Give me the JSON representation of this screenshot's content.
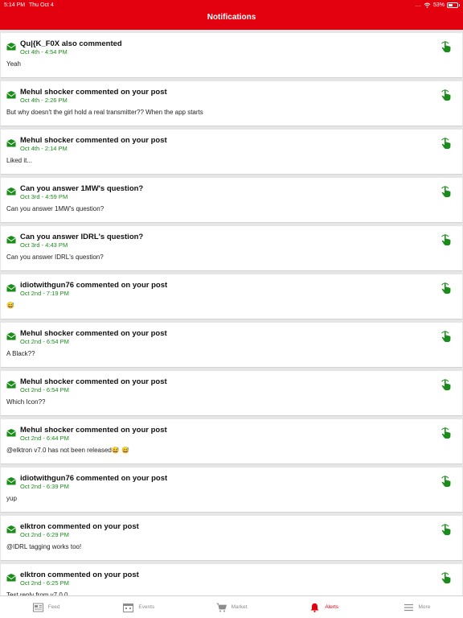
{
  "status": {
    "time": "5:14 PM",
    "date": "Thu Oct 4",
    "battery": "53%",
    "battery_level": 0.53
  },
  "header": {
    "title": "Notifications"
  },
  "notifications": [
    {
      "title": "Qu|{K_F0X also commented",
      "time": "Oct 4th - 4:54 PM",
      "text": "Yeah"
    },
    {
      "title": "Mehul shocker commented on your post",
      "time": "Oct 4th - 2:26 PM",
      "text": "But why doesn't the girl hold a real transmitter?? When the app starts"
    },
    {
      "title": "Mehul shocker commented on your post",
      "time": "Oct 4th - 2:14 PM",
      "text": "Liked it..."
    },
    {
      "title": "Can you answer 1MW's question?",
      "time": "Oct 3rd - 4:59 PM",
      "text": "Can you answer 1MW's question?"
    },
    {
      "title": "Can you answer IDRL's question?",
      "time": "Oct 3rd - 4:43 PM",
      "text": "Can you answer IDRL's question?"
    },
    {
      "title": "idiotwithgun76 commented on your post",
      "time": "Oct 2nd - 7:19 PM",
      "text": "😅"
    },
    {
      "title": "Mehul shocker commented on your post",
      "time": "Oct 2nd - 6:54 PM",
      "text": "A Black??"
    },
    {
      "title": "Mehul shocker commented on your post",
      "time": "Oct 2nd - 6:54 PM",
      "text": "Which Icon??"
    },
    {
      "title": "Mehul shocker commented on your post",
      "time": "Oct 2nd - 6:44 PM",
      "text": "@elktron v7.0 has not been released😅 😅"
    },
    {
      "title": "idiotwithgun76 commented on your post",
      "time": "Oct 2nd - 6:39 PM",
      "text": "yup"
    },
    {
      "title": "elktron commented on your post",
      "time": "Oct 2nd - 6:29 PM",
      "text": "@IDRL tagging works too!"
    },
    {
      "title": "elktron commented on your post",
      "time": "Oct 2nd - 6:25 PM",
      "text": "Test reply from v7.0.0"
    }
  ],
  "tabs": [
    {
      "label": "Feed",
      "icon": "feed-icon"
    },
    {
      "label": "Events",
      "icon": "calendar-icon"
    },
    {
      "label": "Market",
      "icon": "cart-icon"
    },
    {
      "label": "Alerts",
      "icon": "bell-icon"
    },
    {
      "label": "More",
      "icon": "menu-icon"
    }
  ],
  "colors": {
    "accent": "#e3000f",
    "time_green": "#1a8c1a",
    "inactive": "#8c8c8c"
  }
}
